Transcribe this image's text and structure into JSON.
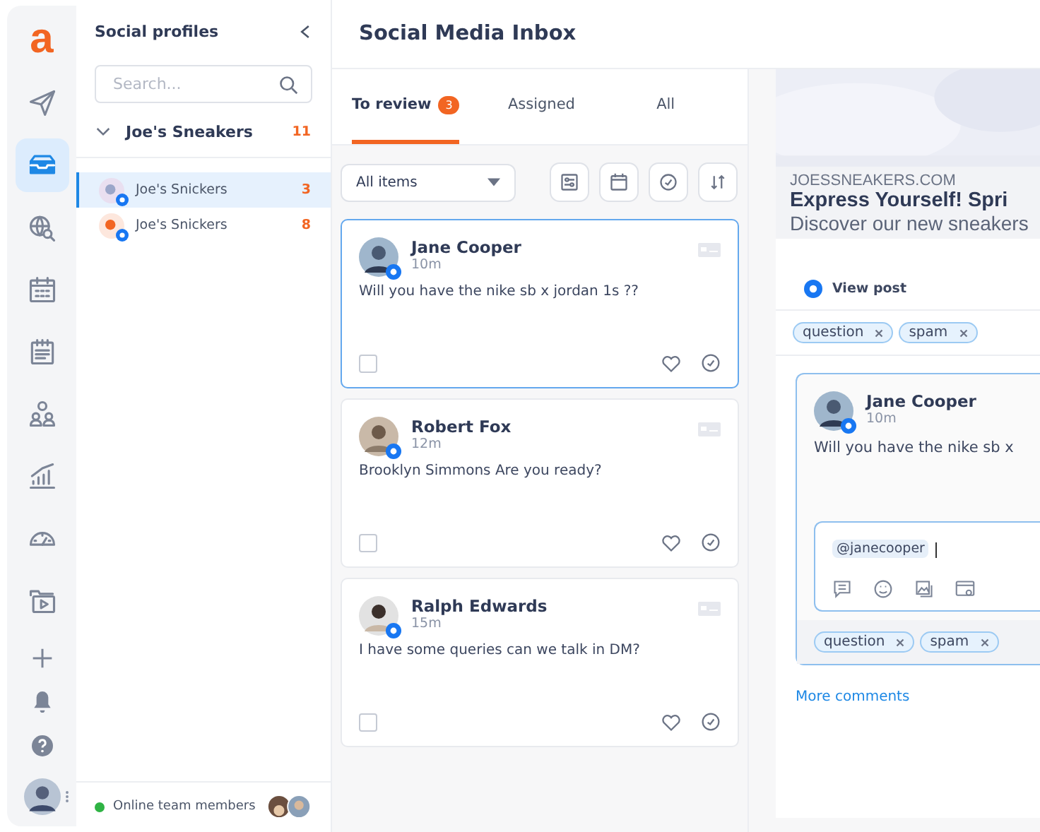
{
  "logo": "a",
  "rail": {
    "items": [
      {
        "kind": "send",
        "selected": false
      },
      {
        "kind": "inbox",
        "selected": true
      },
      {
        "kind": "globe",
        "selected": false
      },
      {
        "kind": "calendar",
        "selected": false
      },
      {
        "kind": "notes",
        "selected": false
      },
      {
        "kind": "people",
        "selected": false
      },
      {
        "kind": "chart",
        "selected": false
      },
      {
        "kind": "gauge",
        "selected": false
      },
      {
        "kind": "media",
        "selected": false
      }
    ],
    "bottom": [
      {
        "kind": "plus"
      },
      {
        "kind": "bell"
      },
      {
        "kind": "help"
      }
    ]
  },
  "profiles": {
    "title": "Social profiles",
    "search": {
      "placeholder": "Search..."
    },
    "group": {
      "name": "Joe's Sneakers",
      "count": "11",
      "expanded": true
    },
    "items": [
      {
        "name": "Joe's Snickers",
        "count": "3",
        "selected": true
      },
      {
        "name": "Joe's Snickers",
        "count": "8",
        "selected": false
      }
    ],
    "online": {
      "label": "Online team members"
    }
  },
  "inbox": {
    "title": "Social Media Inbox",
    "tabs": [
      {
        "label": "To review",
        "badge": "3",
        "selected": true
      },
      {
        "label": "Assigned",
        "selected": false
      },
      {
        "label": "All",
        "selected": false
      }
    ],
    "filter": {
      "value": "All items"
    },
    "tools": [
      {
        "kind": "sliders"
      },
      {
        "kind": "calendar"
      },
      {
        "kind": "check"
      },
      {
        "kind": "sort"
      }
    ],
    "messages": [
      {
        "name": "Jane Cooper",
        "time": "10m",
        "text": "Will you have the nike sb x jordan 1s ??",
        "selected": true,
        "checked": false
      },
      {
        "name": "Robert Fox",
        "time": "12m",
        "text": "Brooklyn Simmons Are you ready?",
        "selected": false,
        "checked": false
      },
      {
        "name": "Ralph Edwards",
        "time": "15m",
        "text": "I have some queries can we talk in DM?",
        "selected": false,
        "checked": false
      }
    ]
  },
  "detail": {
    "preview": {
      "domain": "JOESSNEAKERS.COM",
      "headline": "Express Yourself! Spri",
      "description": "Discover our new sneakers"
    },
    "view_post": "View post",
    "tags": [
      "question",
      "spam"
    ],
    "comment": {
      "name": "Jane Cooper",
      "time": "10m",
      "text": "Will you have the nike sb x",
      "mention": "@janecooper",
      "tags": [
        "question",
        "spam"
      ]
    },
    "more": "More comments"
  }
}
